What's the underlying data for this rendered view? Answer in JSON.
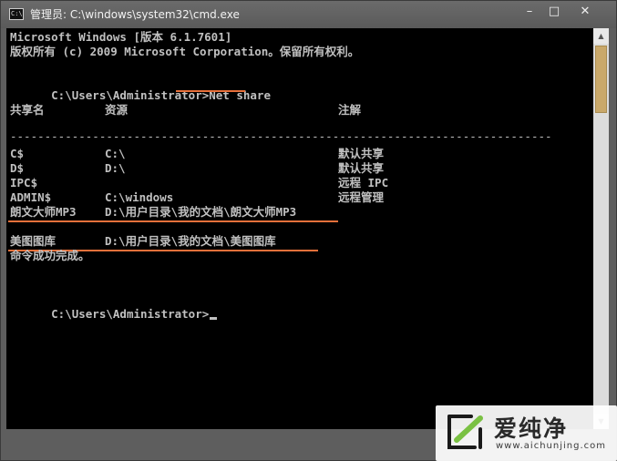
{
  "window": {
    "title": "管理员: C:\\windows\\system32\\cmd.exe",
    "icon_label": "C:\\",
    "minimize": "–",
    "maximize": "□",
    "close": "✕"
  },
  "console": {
    "header_line1": "Microsoft Windows [版本 6.1.7601]",
    "header_line2": "版权所有 (c) 2009 Microsoft Corporation。保留所有权利。",
    "prompt": "C:\\Users\\Administrator>",
    "command": "Net share",
    "columns": {
      "share_name": "共享名",
      "resource": "资源",
      "remark": "注解"
    },
    "separator": "-------------------------------------------------------------------------------",
    "rows": [
      {
        "name": "C$",
        "resource": "C:\\",
        "remark": "默认共享"
      },
      {
        "name": "D$",
        "resource": "D:\\",
        "remark": "默认共享"
      },
      {
        "name": "IPC$",
        "resource": "",
        "remark": "远程 IPC"
      },
      {
        "name": "ADMIN$",
        "resource": "C:\\windows",
        "remark": "远程管理"
      },
      {
        "name": "朗文大师MP3",
        "resource": "D:\\用户目录\\我的文档\\朗文大师MP3",
        "remark": ""
      },
      {
        "name": "美图图库",
        "resource": "D:\\用户目录\\我的文档\\美图图库",
        "remark": ""
      }
    ],
    "completed": "命令成功完成。",
    "final_prompt": "C:\\Users\\Administrator>"
  },
  "watermark": {
    "brand": "爱纯净",
    "url": "www.aichunjing.com"
  },
  "colors": {
    "console_bg": "#000000",
    "console_text": "#c0c0c0",
    "highlight_underline": "#e8703a"
  }
}
